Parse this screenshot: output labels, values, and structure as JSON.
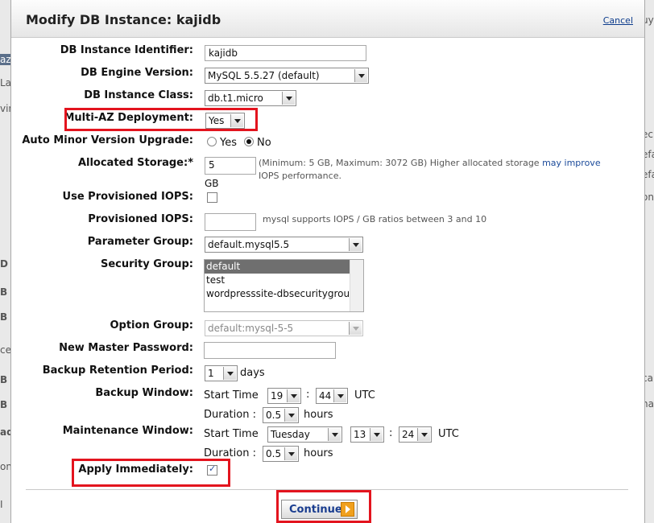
{
  "background": {
    "left_fragments": [
      "az",
      "La",
      "vin",
      "D",
      "B I",
      "B I",
      "ce",
      "B S",
      "B S",
      "ad",
      "on",
      "I"
    ],
    "right_fragments": [
      "uy",
      "ec",
      "efa",
      "efa",
      "on",
      "ca",
      "na"
    ]
  },
  "dialog": {
    "title": "Modify DB Instance: kajidb",
    "cancel": "Cancel"
  },
  "form": {
    "db_instance_identifier": {
      "label": "DB Instance Identifier:",
      "value": "kajidb"
    },
    "db_engine_version": {
      "label": "DB Engine Version:",
      "value": "MySQL 5.5.27 (default)"
    },
    "db_instance_class": {
      "label": "DB Instance Class:",
      "value": "db.t1.micro"
    },
    "multi_az": {
      "label": "Multi-AZ Deployment:",
      "value": "Yes"
    },
    "auto_minor": {
      "label": "Auto Minor Version Upgrade:",
      "yes": "Yes",
      "no": "No",
      "selected": "No"
    },
    "allocated_storage": {
      "label": "Allocated Storage:*",
      "value": "5",
      "unit": "GB",
      "note_before_link": "(Minimum: 5 GB, Maximum: 3072 GB) Higher allocated storage ",
      "note_link": "may improve",
      "note_after_link": "IOPS performance."
    },
    "use_piops": {
      "label": "Use Provisioned IOPS:",
      "checked": false
    },
    "piops": {
      "label": "Provisioned IOPS:",
      "value": "",
      "note": "mysql supports IOPS / GB ratios between 3 and 10"
    },
    "parameter_group": {
      "label": "Parameter Group:",
      "value": "default.mysql5.5"
    },
    "security_group": {
      "label": "Security Group:",
      "options": [
        "default",
        "test",
        "wordpresssite-dbsecuritygroup-"
      ],
      "selected": "default"
    },
    "option_group": {
      "label": "Option Group:",
      "value": "default:mysql-5-5"
    },
    "master_password": {
      "label": "New Master Password:",
      "value": ""
    },
    "backup_retention": {
      "label": "Backup Retention Period:",
      "value": "1",
      "unit": "days"
    },
    "backup_window": {
      "label": "Backup Window:",
      "start_label": "Start Time",
      "hour": "19",
      "sep": ":",
      "minute": "44",
      "tz": "UTC",
      "duration_label": "Duration :",
      "duration": "0.5",
      "duration_unit": "hours"
    },
    "maintenance_window": {
      "label": "Maintenance Window:",
      "start_label": "Start Time",
      "day": "Tuesday",
      "hour": "13",
      "sep": ":",
      "minute": "24",
      "tz": "UTC",
      "duration_label": "Duration :",
      "duration": "0.5",
      "duration_unit": "hours"
    },
    "apply_immediately": {
      "label": "Apply Immediately:",
      "checked": true
    }
  },
  "buttons": {
    "continue": "Continue"
  },
  "colors": {
    "highlight": "#e3141e",
    "selected_option": "#6f6f6f",
    "link": "#1a4a9a"
  }
}
